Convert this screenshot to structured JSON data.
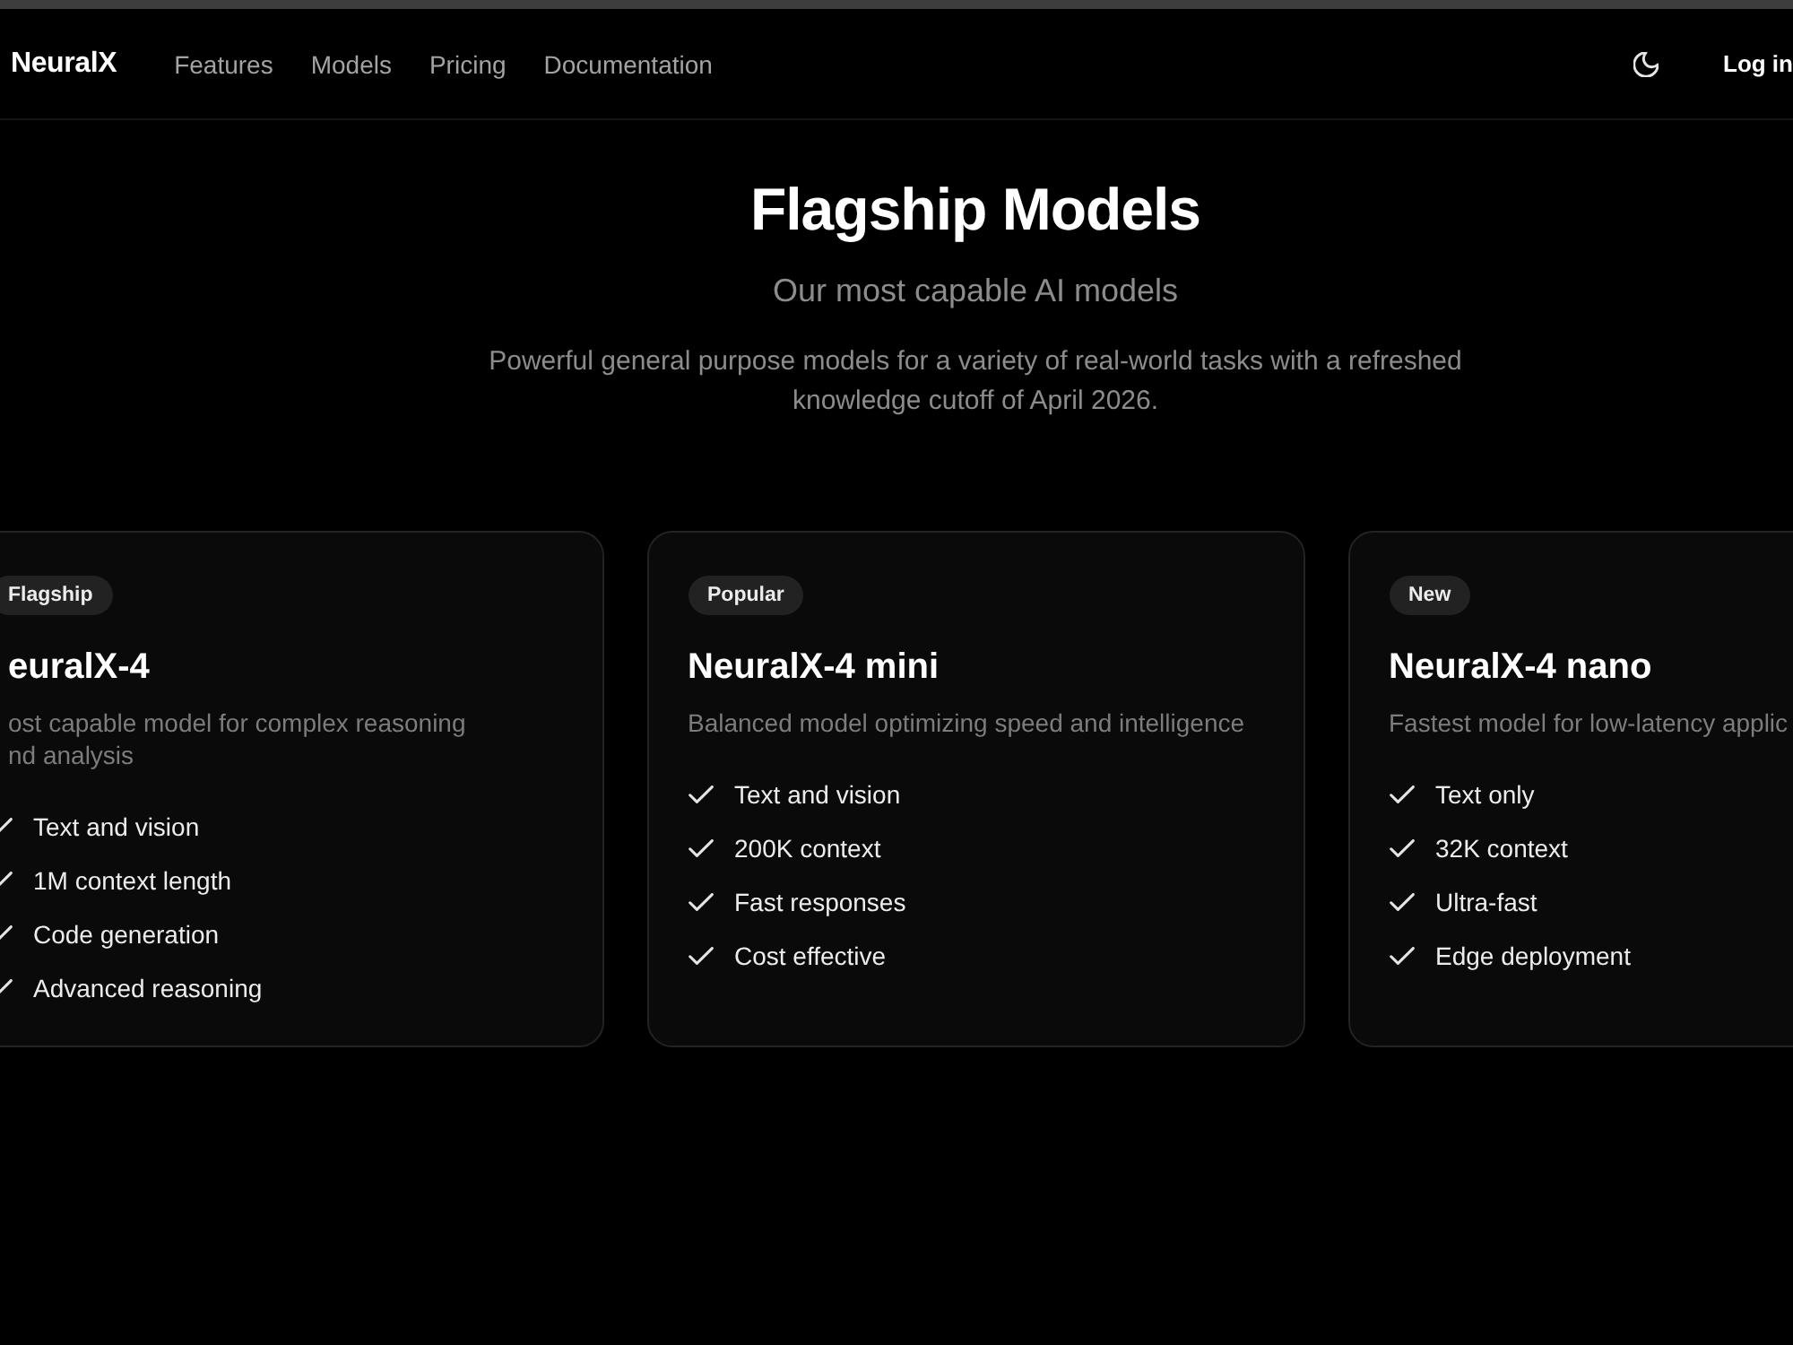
{
  "nav": {
    "logo": "NeuralX",
    "links": [
      "Features",
      "Models",
      "Pricing",
      "Documentation"
    ],
    "login": "Log in"
  },
  "hero": {
    "title": "Flagship Models",
    "subtitle": "Our most capable AI models",
    "description": "Powerful general purpose models for a variety of real-world tasks with a refreshed knowledge cutoff of April 2026."
  },
  "models": [
    {
      "badge": "Flagship",
      "name": "euralX-4",
      "description": "ost capable model for complex reasoning nd analysis",
      "features": [
        "Text and vision",
        "1M context length",
        "Code generation",
        "Advanced reasoning"
      ]
    },
    {
      "badge": "Popular",
      "name": "NeuralX-4 mini",
      "description": "Balanced model optimizing speed and intelligence",
      "features": [
        "Text and vision",
        "200K context",
        "Fast responses",
        "Cost effective"
      ]
    },
    {
      "badge": "New",
      "name": "NeuralX-4 nano",
      "description": "Fastest model for low-latency applic",
      "features": [
        "Text only",
        "32K context",
        "Ultra-fast",
        "Edge deployment"
      ]
    }
  ]
}
